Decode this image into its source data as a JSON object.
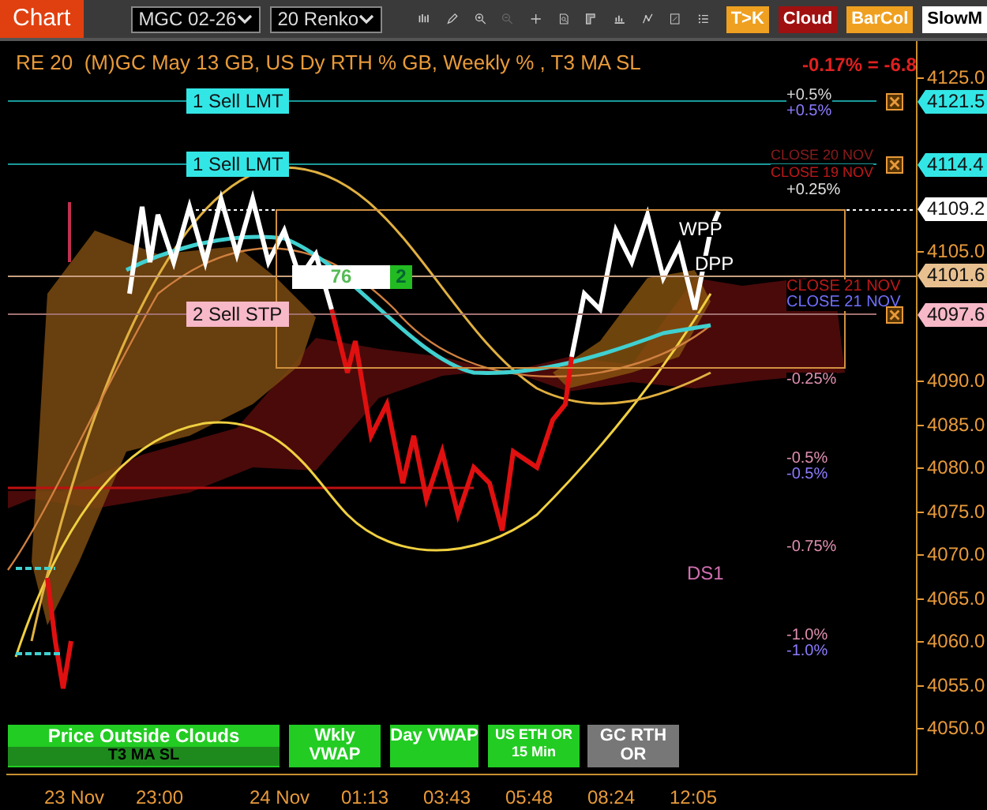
{
  "toolbar": {
    "title": "Chart",
    "instrument": "MGC 02-26",
    "period": "20 Renko",
    "toggles": [
      {
        "label": "T>K",
        "color": "#f0a020"
      },
      {
        "label": "Cloud",
        "color": "#a01010"
      },
      {
        "label": "BarCol",
        "color": "#f0a020"
      },
      {
        "label": "SlowM",
        "color": "#ffffff"
      }
    ]
  },
  "chart": {
    "header": "RE 20  (M)GC May 13 GB, US Dy RTH % GB, Weekly % , T3 MA SL",
    "change": "-0.17% = -6.8",
    "orders": [
      {
        "label": "1 Sell LMT",
        "price": "4121.5",
        "color": "#33e6e6"
      },
      {
        "label": "1 Sell LMT",
        "price": "4114.4",
        "color": "#33e6e6"
      },
      {
        "label": "2 Sell STP",
        "price": "4097.6",
        "color": "#f7b8c8"
      }
    ],
    "position": {
      "quantity": "76",
      "count": "2"
    },
    "price_markers": [
      {
        "price": "4109.2",
        "color": "#ffffff"
      },
      {
        "price": "4101.6",
        "color": "#e8c090"
      }
    ],
    "level_labels": [
      {
        "text": "+0.5%",
        "color": "#d8d8d8"
      },
      {
        "text": "+0.5%",
        "color": "#8c7cff"
      },
      {
        "text": "CLOSE 20 NOV",
        "color": "#8a1c1c"
      },
      {
        "text": "CLOSE 19 NOV",
        "color": "#c01818"
      },
      {
        "text": "+0.25%",
        "color": "#e0e0e0"
      },
      {
        "text": "WPP",
        "color": "#ffffff"
      },
      {
        "text": "DPP",
        "color": "#ffffff"
      },
      {
        "text": "CLOSE 21 NOV",
        "color": "#c01818"
      },
      {
        "text": "CLOSE 21 NOV",
        "color": "#7070ff"
      },
      {
        "text": "-0.25%",
        "color": "#e090b0"
      },
      {
        "text": "-0.5%",
        "color": "#e090b0"
      },
      {
        "text": "-0.5%",
        "color": "#8c7cff"
      },
      {
        "text": "-0.75%",
        "color": "#e090b0"
      },
      {
        "text": "DS1",
        "color": "#d070b0"
      },
      {
        "text": "-1.0%",
        "color": "#e090b0"
      },
      {
        "text": "-1.0%",
        "color": "#8c7cff"
      }
    ],
    "y_ticks": [
      "4125.0",
      "4105.0",
      "4090.0",
      "4085.0",
      "4080.0",
      "4075.0",
      "4070.0",
      "4065.0",
      "4060.0",
      "4055.0",
      "4050.0"
    ],
    "x_ticks": [
      "23 Nov",
      "23:00",
      "24 Nov",
      "01:13",
      "03:43",
      "05:48",
      "08:24",
      "12:05"
    ],
    "indicator_buttons": [
      {
        "label": "Price Outside Clouds",
        "subtitle": "T3 MA SL",
        "color": "#22cc22"
      },
      {
        "label": "Wkly VWAP",
        "color": "#22cc22"
      },
      {
        "label": "Day VWAP",
        "color": "#22cc22"
      },
      {
        "label": "US ETH OR 15 Min",
        "color": "#22cc22"
      },
      {
        "label": "GC RTH OR",
        "color": "#777777"
      }
    ]
  }
}
